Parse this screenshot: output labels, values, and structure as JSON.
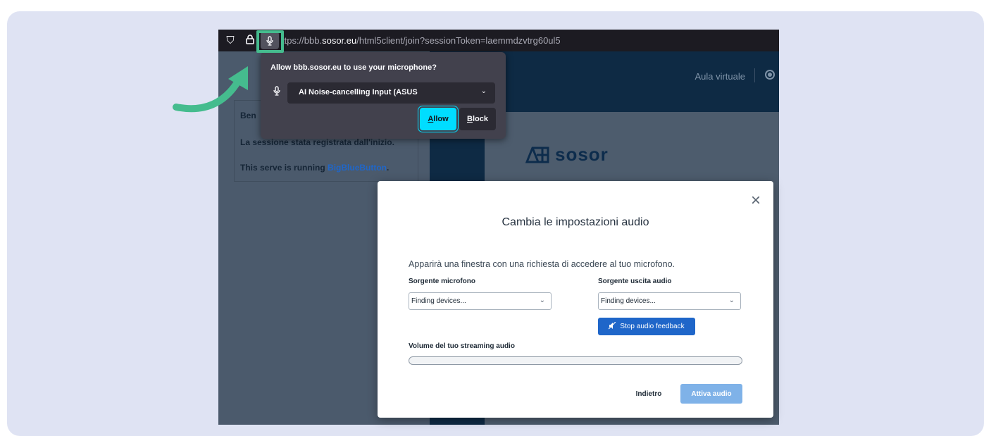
{
  "browser": {
    "url_prefix": "ttps://bbb.",
    "url_domain": "sosor.eu",
    "url_path": "/html5client/join?sessionToken=laemmdzvtrg60ul5",
    "icons": [
      "shield-icon",
      "lock-icon",
      "microphone-icon"
    ]
  },
  "page": {
    "header_title": "Aula virtuale",
    "logo_text": "sosor",
    "chat": {
      "line1": "Ben",
      "line2": "La sessione   stata registrata dall'inizio.",
      "line3_prefix": "This serve   is running ",
      "line3_link": "BigBlueButton",
      "line3_suffix": "."
    }
  },
  "permission_popup": {
    "title": "Allow bbb.sosor.eu to use your microphone?",
    "device": "AI Noise-cancelling Input (ASUS",
    "allow_label_ul": "A",
    "allow_label_rest": "llow",
    "block_label_ul": "B",
    "block_label_rest": "lock"
  },
  "audio_modal": {
    "close": "×",
    "title": "Cambia le impostazioni audio",
    "description": "Apparirà una finestra con una richiesta di accedere al tuo microfono.",
    "mic_source_label": "Sorgente microfono",
    "mic_source_value": "Finding devices...",
    "output_source_label": "Sorgente uscita audio",
    "output_source_value": "Finding devices...",
    "stop_feedback_label": "Stop audio feedback",
    "volume_label": "Volume del tuo streaming audio",
    "volume_level": 0,
    "back_label": "Indietro",
    "activate_label": "Attiva audio"
  },
  "colors": {
    "highlight": "#45bc8e",
    "allow_button": "#00ddff",
    "primary_blue": "#1f66c9"
  }
}
